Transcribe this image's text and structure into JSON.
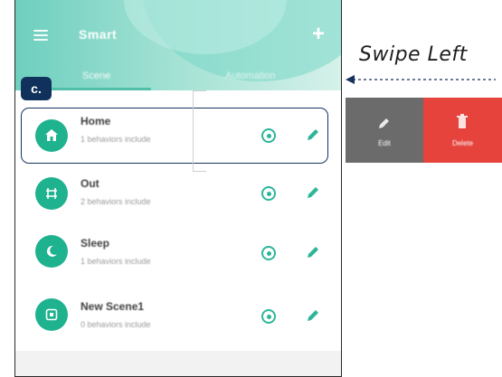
{
  "header": {
    "title": "Smart",
    "tabs": [
      {
        "label": "Scene",
        "active": true
      },
      {
        "label": "Automation",
        "active": false
      }
    ]
  },
  "badge": {
    "label": "c."
  },
  "scenes": [
    {
      "name": "Home",
      "subtitle": "1 behaviors include",
      "icon": "house-icon",
      "selected": true
    },
    {
      "name": "Out",
      "subtitle": "2 behaviors include",
      "icon": "grid-icon",
      "selected": false
    },
    {
      "name": "Sleep",
      "subtitle": "1 behaviors include",
      "icon": "moon-icon",
      "selected": false
    },
    {
      "name": "New Scene1",
      "subtitle": "0 behaviors include",
      "icon": "frame-icon",
      "selected": false
    }
  ],
  "swipe": {
    "label": "Swipe Left",
    "actions": [
      {
        "label": "Edit",
        "icon": "pencil-icon",
        "color": "#6b6b6b"
      },
      {
        "label": "Delete",
        "icon": "trash-icon",
        "color": "#e5433c"
      }
    ]
  },
  "colors": {
    "accent": "#1fb28f",
    "badge": "#10315c",
    "delete": "#e5433c"
  }
}
